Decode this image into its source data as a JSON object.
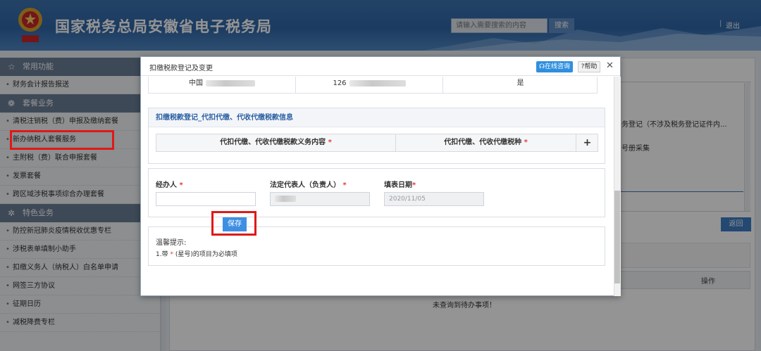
{
  "header": {
    "site_title": "国家税务总局安徽省电子税务局",
    "search_placeholder": "请输入需要搜索的内容",
    "search_button": "搜索",
    "separator": "|",
    "logout": "退出"
  },
  "sidebar": {
    "groups": [
      {
        "icon": "☆",
        "label": "常用功能",
        "items": [
          "财务会计报告报送"
        ]
      },
      {
        "icon": "❁",
        "label": "套餐业务",
        "items": [
          "清税注销税（费）申报及缴纳套餐",
          "新办纳税人套餐服务",
          "主附税（费）联合申报套餐",
          "发票套餐",
          "跨区域涉税事项综合办理套餐"
        ]
      },
      {
        "icon": "✲",
        "label": "特色业务",
        "items": [
          "防控新冠肺炎疫情税收优惠专栏",
          "涉税表单填制小助手",
          "扣缴义务人（纳税人）白名单申请",
          "网签三方协议",
          "征期日历",
          "减税降费专栏"
        ]
      }
    ]
  },
  "background": {
    "text1": "务登记（不涉及税务登记证件内...",
    "text2": "号册采集",
    "back_button": "返回",
    "table_col_ops": "操作",
    "empty_text": "未查询到待办事项！"
  },
  "modal": {
    "title": "扣缴税款登记及变更",
    "consult_button": "在线咨询",
    "help_button": "帮助",
    "close": "✕",
    "top_row": {
      "c1": "中国",
      "c2": "126",
      "c3": "是"
    },
    "section_title": "扣缴税款登记_代扣代缴、代收代缴税款信息",
    "col1": "代扣代缴、代收代缴税款义务内容",
    "col2": "代扣代缴、代收代缴税种",
    "required_mark": "*",
    "add_button": "+",
    "form": {
      "handler_label": "经办人",
      "legal_rep_label": "法定代表人（负责人）",
      "fill_date_label": "填表日期",
      "handler_value": "",
      "legal_rep_value": "",
      "fill_date_value": "2020/11/05"
    },
    "tips": {
      "title": "温馨提示:",
      "line1_prefix": "1.带",
      "line1_suffix": "(星号)的项目为必填项"
    },
    "save_button": "保存"
  },
  "colors": {
    "header_blue": "#3c72b0",
    "primary_button": "#3d8fe4",
    "highlight_red": "#e01818",
    "required_red": "#e53a3a"
  }
}
